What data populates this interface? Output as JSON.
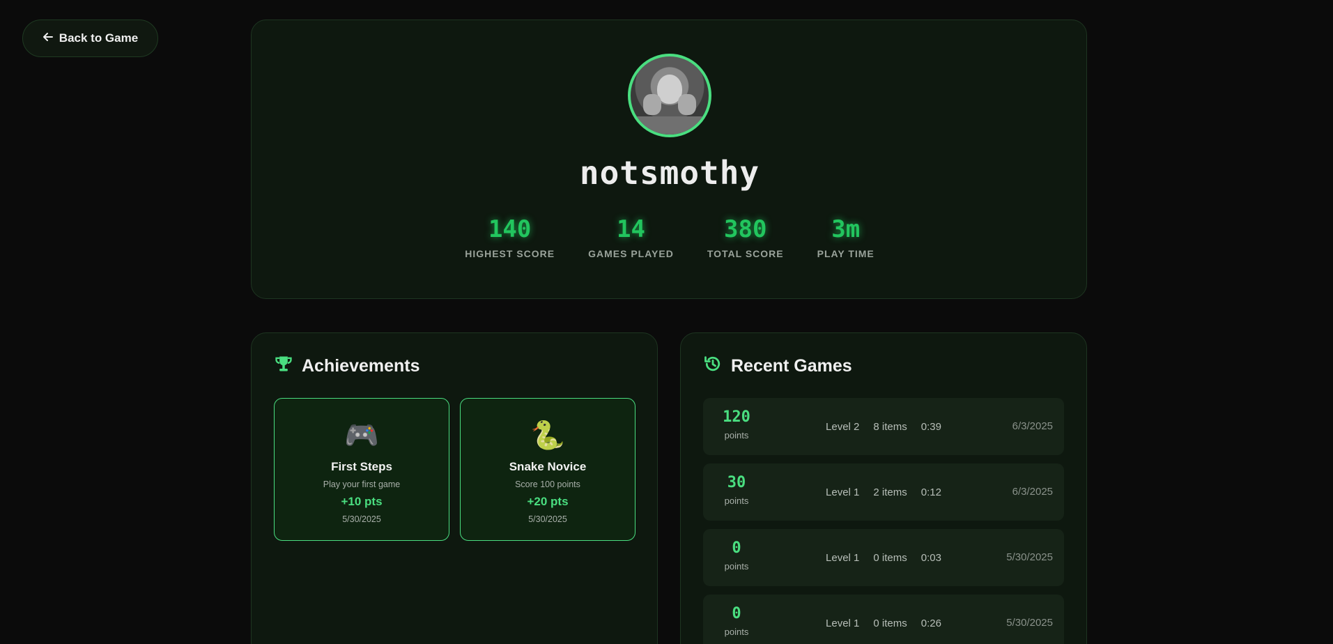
{
  "nav": {
    "back_label": "Back to Game",
    "back_icon": "arrow-left-icon"
  },
  "profile": {
    "username": "notsmothy",
    "accent_color": "#4ade80",
    "stats": [
      {
        "value": "140",
        "label": "HIGHEST SCORE"
      },
      {
        "value": "14",
        "label": "GAMES PLAYED"
      },
      {
        "value": "380",
        "label": "TOTAL SCORE"
      },
      {
        "value": "3m",
        "label": "PLAY TIME"
      }
    ]
  },
  "achievements": {
    "title": "Achievements",
    "icon": "trophy-icon",
    "items": [
      {
        "emoji": "🎮",
        "name": "First Steps",
        "description": "Play your first game",
        "points": "+10 pts",
        "date": "5/30/2025"
      },
      {
        "emoji": "🐍",
        "name": "Snake Novice",
        "description": "Score 100 points",
        "points": "+20 pts",
        "date": "5/30/2025"
      }
    ]
  },
  "recent_games": {
    "title": "Recent Games",
    "icon": "history-icon",
    "points_label": "points",
    "items": [
      {
        "score": "120",
        "level": "Level 2",
        "items": "8 items",
        "time": "0:39",
        "date": "6/3/2025"
      },
      {
        "score": "30",
        "level": "Level 1",
        "items": "2 items",
        "time": "0:12",
        "date": "6/3/2025"
      },
      {
        "score": "0",
        "level": "Level 1",
        "items": "0 items",
        "time": "0:03",
        "date": "5/30/2025"
      },
      {
        "score": "0",
        "level": "Level 1",
        "items": "0 items",
        "time": "0:26",
        "date": "5/30/2025"
      }
    ]
  }
}
